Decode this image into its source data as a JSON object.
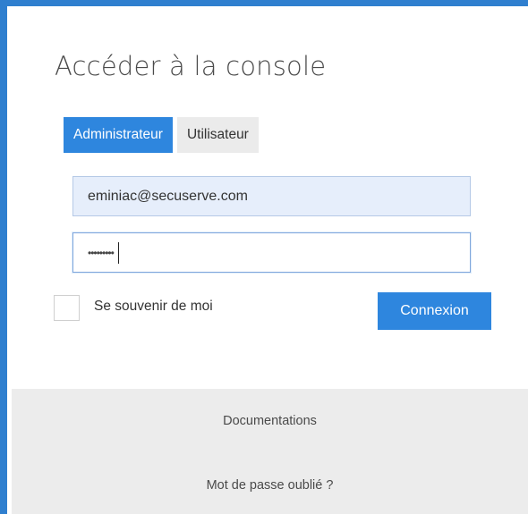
{
  "login": {
    "title": "Accéder à la console",
    "tabs": [
      {
        "label": "Administrateur",
        "active": true
      },
      {
        "label": "Utilisateur",
        "active": false
      }
    ],
    "email_value": "eminiac@secuserve.com",
    "password_masked": "•••••••••",
    "remember_label": "Se souvenir de moi",
    "remember_checked": false,
    "submit_label": "Connexion"
  },
  "footer": {
    "documentation_link": "Documentations",
    "forgot_password_link": "Mot de passe oublié ?"
  },
  "colors": {
    "accent": "#2e86de",
    "window_edge": "#2f7fcf",
    "footer_bg": "#ececec",
    "email_bg": "#e6eefb"
  }
}
